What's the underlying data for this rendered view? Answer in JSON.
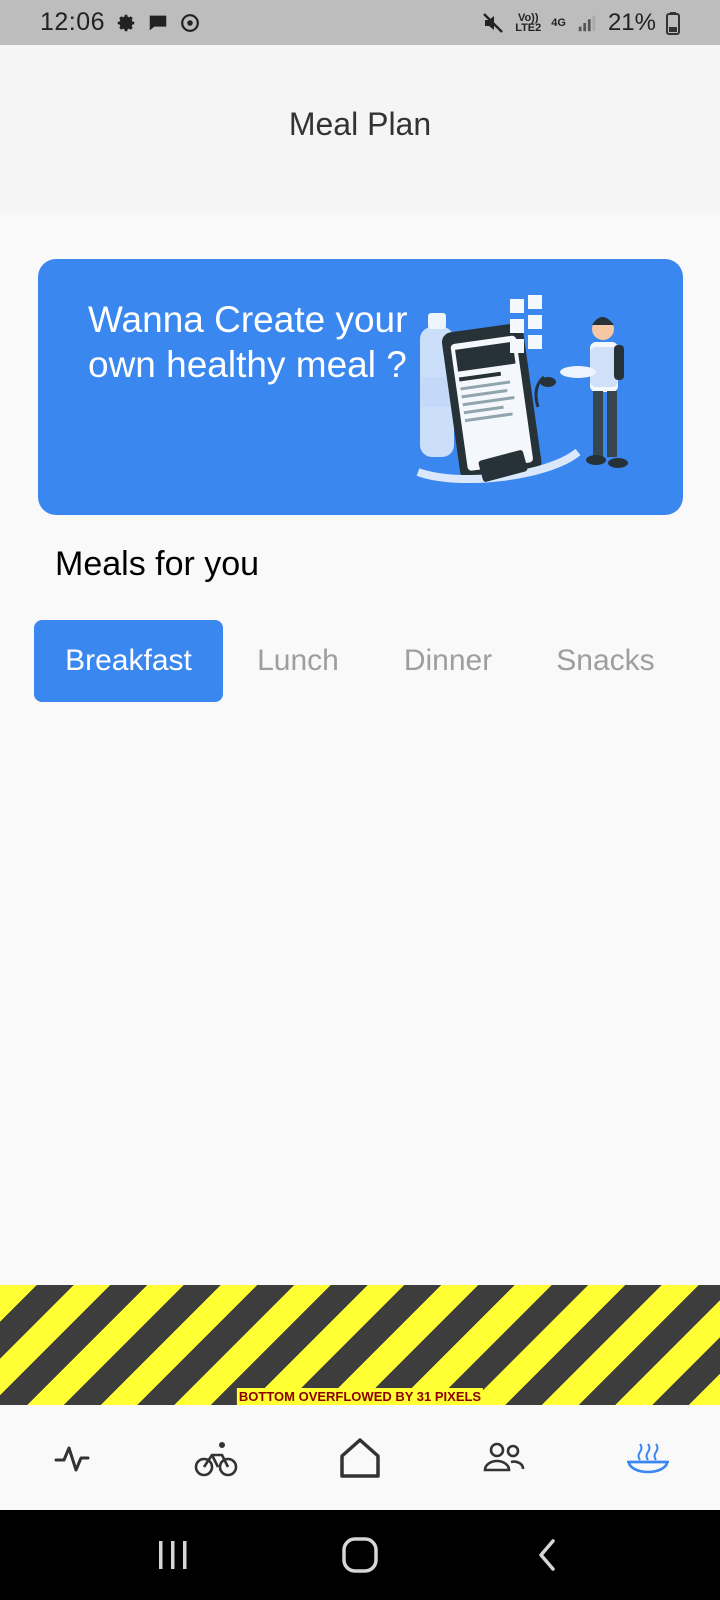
{
  "status_bar": {
    "time": "12:06",
    "network_top": "Vo))",
    "network_bottom": "LTE2",
    "network_type": "4G",
    "battery_percent": "21%",
    "icons": [
      "settings-icon",
      "message-icon",
      "sync-icon",
      "mute-icon",
      "signal-icon",
      "battery-icon"
    ]
  },
  "header": {
    "title": "Meal Plan"
  },
  "banner": {
    "text": "Wanna Create your own healthy meal ?",
    "illustration": "healthy-meal-illustration",
    "color": "#3b87f0"
  },
  "meals_section": {
    "title": "Meals for you",
    "tabs": [
      {
        "label": "Breakfast",
        "active": true
      },
      {
        "label": "Lunch",
        "active": false
      },
      {
        "label": "Dinner",
        "active": false
      },
      {
        "label": "Snacks",
        "active": false
      }
    ]
  },
  "overflow_warning": {
    "text": "BOTTOM OVERFLOWED BY 31 PIXELS"
  },
  "bottom_nav": {
    "items": [
      {
        "icon": "activity-icon",
        "active": false
      },
      {
        "icon": "bicycle-icon",
        "active": false
      },
      {
        "icon": "home-icon",
        "active": false
      },
      {
        "icon": "community-icon",
        "active": false
      },
      {
        "icon": "meal-bowl-icon",
        "active": true
      }
    ],
    "active_color": "#3b87f0",
    "inactive_color": "#333333"
  },
  "system_nav": {
    "buttons": [
      "recent-apps-icon",
      "home-button-icon",
      "back-icon"
    ]
  }
}
